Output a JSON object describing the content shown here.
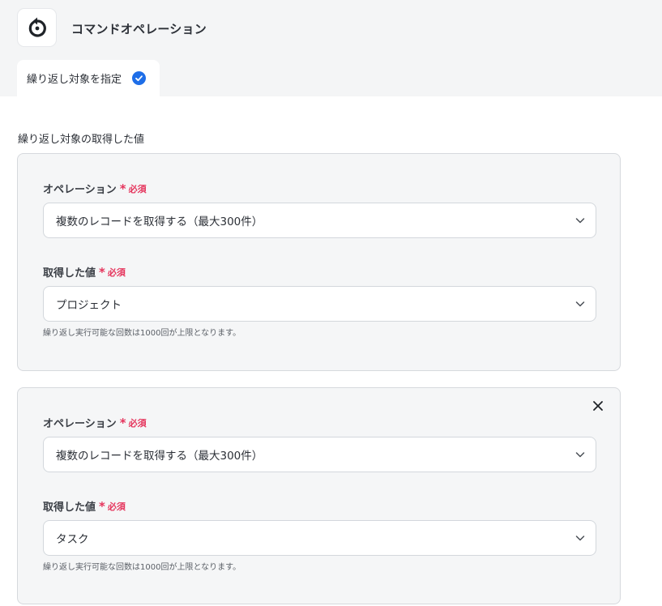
{
  "header": {
    "title": "コマンドオペレーション",
    "icon": "refresh-icon"
  },
  "tabs": [
    {
      "label": "繰り返し対象を指定",
      "status_icon": "check-circle-icon",
      "accent": "#1e6ee8"
    }
  ],
  "section": {
    "title": "繰り返し対象の取得した値"
  },
  "colors": {
    "required": "#e5345c",
    "accent": "#1e6ee8"
  },
  "cards": [
    {
      "operation_label": "オペレーション",
      "required_mark": "*",
      "required_text": "必須",
      "operation_value": "複数のレコードを取得する（最大300件）",
      "value_label": "取得した値",
      "value_value": "プロジェクト",
      "helper": "繰り返し実行可能な回数は1000回が上限となります。",
      "removable": false
    },
    {
      "operation_label": "オペレーション",
      "required_mark": "*",
      "required_text": "必須",
      "operation_value": "複数のレコードを取得する（最大300件）",
      "value_label": "取得した値",
      "value_value": "タスク",
      "helper": "繰り返し実行可能な回数は1000回が上限となります。",
      "removable": true
    }
  ]
}
